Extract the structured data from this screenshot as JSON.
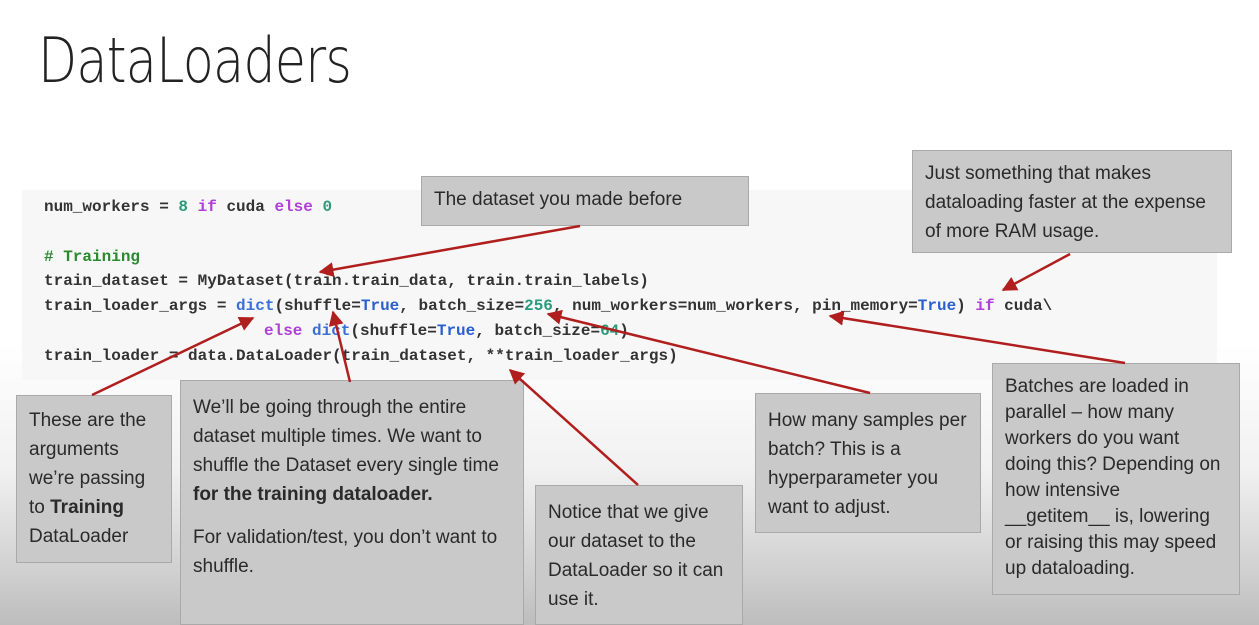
{
  "title": "DataLoaders",
  "code": {
    "line1": {
      "a": "num_workers = ",
      "b": "8",
      "c": " if ",
      "d": "cuda",
      "e": " else ",
      "f": "0"
    },
    "comment": "# Training",
    "line3": "train_dataset = MyDataset(train.train_data, train.train_labels)",
    "line4": {
      "a": "train_loader_args = ",
      "b": "dict",
      "c": "(shuffle=",
      "d": "True",
      "e": ", batch_size=",
      "f": "256",
      "g": ", num_workers=num_workers, pin_memory=",
      "h": "True",
      "i": ") ",
      "j": "if",
      "k": " cuda\\"
    },
    "line5": {
      "a": "else ",
      "b": "dict",
      "c": "(shuffle=",
      "d": "True",
      "e": ", batch_size=",
      "f": "64",
      "g": ")"
    },
    "line6": "train_loader = data.DataLoader(train_dataset, **train_loader_args)"
  },
  "callouts": {
    "dataset": "The dataset you made before",
    "workers_ram": "Just something that makes dataloading faster at the expense of more RAM usage.",
    "args": {
      "pre": "These are the arguments we’re passing to ",
      "bold": "Training",
      "post": " DataLoader"
    },
    "shuffle": {
      "pre": "We’ll be going through the entire dataset multiple times. We want to shuffle the Dataset every single time ",
      "bold": "for the training dataloader.",
      "p2": "For validation/test, you don’t want to shuffle."
    },
    "give_dataset": "Notice that we give our dataset to the DataLoader so it can use it.",
    "batch": "How many samples per batch? This is a hyperparameter you want to adjust.",
    "parallel": "Batches are loaded in parallel – how many workers do you want doing this? Depending on how intensive __getitem__ is, lowering or raising this may speed up dataloading."
  },
  "colors": {
    "arrow": "#b01e1e",
    "callout_bg": "#c9c9c9"
  }
}
